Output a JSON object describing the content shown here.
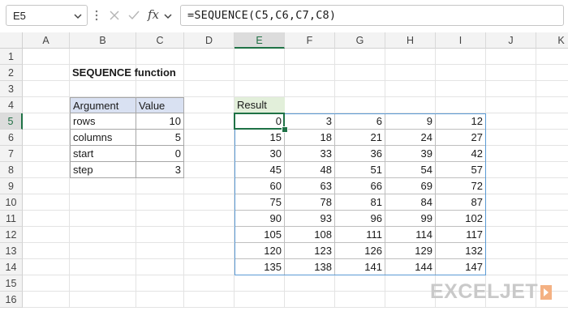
{
  "formula_bar": {
    "name_box": "E5",
    "formula": "=SEQUENCE(C5,C6,C7,C8)",
    "fx_label": "fx"
  },
  "columns": [
    "A",
    "B",
    "C",
    "D",
    "E",
    "F",
    "G",
    "H",
    "I",
    "J",
    "K"
  ],
  "rows": [
    "1",
    "2",
    "3",
    "4",
    "5",
    "6",
    "7",
    "8",
    "9",
    "10",
    "11",
    "12",
    "13",
    "14",
    "15",
    "16"
  ],
  "selected": {
    "column": "E",
    "row": "5"
  },
  "sheet": {
    "title": "SEQUENCE function",
    "arg_table": {
      "headers": [
        "Argument",
        "Value"
      ],
      "rows": [
        [
          "rows",
          "10"
        ],
        [
          "columns",
          "5"
        ],
        [
          "start",
          "0"
        ],
        [
          "step",
          "3"
        ]
      ]
    },
    "result_header": "Result",
    "result_values": [
      [
        "0",
        "3",
        "6",
        "9",
        "12"
      ],
      [
        "15",
        "18",
        "21",
        "24",
        "27"
      ],
      [
        "30",
        "33",
        "36",
        "39",
        "42"
      ],
      [
        "45",
        "48",
        "51",
        "54",
        "57"
      ],
      [
        "60",
        "63",
        "66",
        "69",
        "72"
      ],
      [
        "75",
        "78",
        "81",
        "84",
        "87"
      ],
      [
        "90",
        "93",
        "96",
        "99",
        "102"
      ],
      [
        "105",
        "108",
        "111",
        "114",
        "117"
      ],
      [
        "120",
        "123",
        "126",
        "129",
        "132"
      ],
      [
        "135",
        "138",
        "141",
        "144",
        "147"
      ]
    ]
  },
  "logo": {
    "text": "EXCELJET"
  },
  "colors": {
    "selection": "#1f7246",
    "header_fill": "#d9e1f2",
    "result_fill": "#e2efda",
    "logo": "#c6c6c6"
  }
}
